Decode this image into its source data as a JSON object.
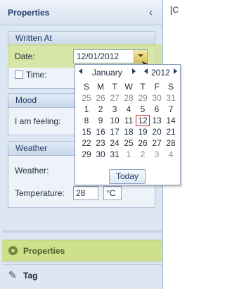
{
  "panel": {
    "title": "Properties"
  },
  "right_tab": {
    "label": "[C"
  },
  "written_at": {
    "header": "Written At",
    "date_label": "Date:",
    "date_value": "12/01/2012",
    "time_label": "Time:"
  },
  "mood": {
    "header": "Mood",
    "feeling_label": "I am feeling:"
  },
  "weather": {
    "header": "Weather",
    "weather_label": "Weather:",
    "temperature_label": "Temperature:",
    "temperature_value": "28",
    "unit_value": "°C"
  },
  "calendar": {
    "month": "January",
    "year": "2012",
    "weekdays": [
      "S",
      "M",
      "T",
      "W",
      "T",
      "F",
      "S"
    ],
    "weeks": [
      [
        "25",
        "26",
        "27",
        "28",
        "29",
        "30",
        "31"
      ],
      [
        "1",
        "2",
        "3",
        "4",
        "5",
        "6",
        "7"
      ],
      [
        "8",
        "9",
        "10",
        "11",
        "12",
        "13",
        "14"
      ],
      [
        "15",
        "16",
        "17",
        "18",
        "19",
        "20",
        "21"
      ],
      [
        "22",
        "23",
        "24",
        "25",
        "26",
        "27",
        "28"
      ],
      [
        "29",
        "30",
        "31",
        "1",
        "2",
        "3",
        "4"
      ]
    ],
    "selected_day": "12",
    "today_label": "Today"
  },
  "nav": {
    "properties_label": "Properties",
    "tag_label": "Tag"
  },
  "colors": {
    "highlight": "#cfe08a",
    "panel_bg": "#dde7f3",
    "selected_border": "#c0392b"
  }
}
